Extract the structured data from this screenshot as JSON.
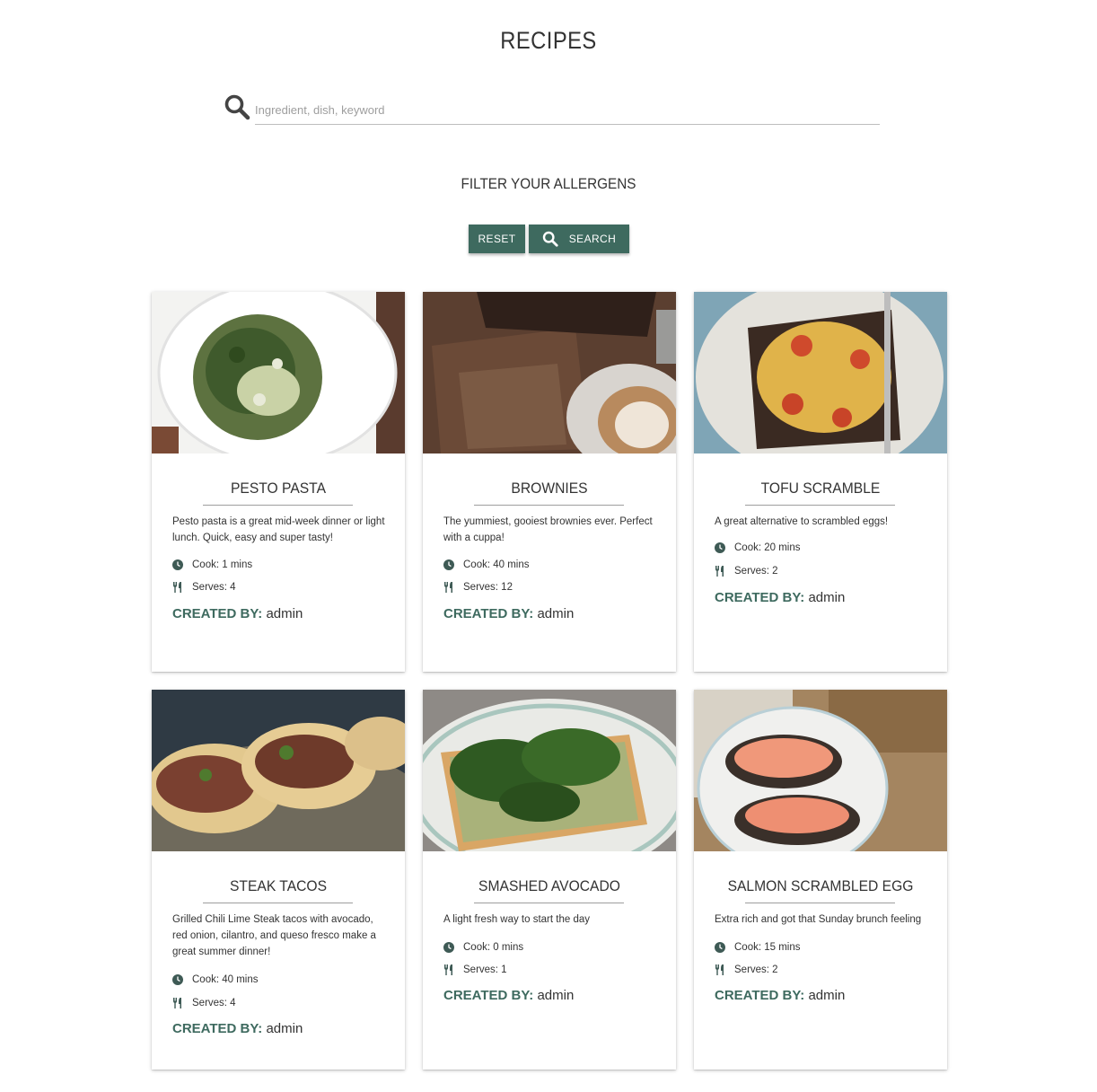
{
  "page": {
    "title": "RECIPES"
  },
  "search": {
    "placeholder": "Ingredient, dish, keyword",
    "value": ""
  },
  "filter": {
    "title": "FILTER YOUR ALLERGENS",
    "reset_label": "RESET",
    "search_label": "SEARCH"
  },
  "colors": {
    "accent": "#3e6a5f"
  },
  "recipes": [
    {
      "title": "PESTO PASTA",
      "description": "Pesto pasta is a great mid-week dinner or light lunch. Quick, easy and super tasty!",
      "cook": "Cook: 1 mins",
      "serves": "Serves: 4",
      "created_label": "CREATED BY:",
      "author": "admin"
    },
    {
      "title": "BROWNIES",
      "description": "The yummiest, gooiest brownies ever. Perfect with a cuppa!",
      "cook": "Cook: 40 mins",
      "serves": "Serves: 12",
      "created_label": "CREATED BY:",
      "author": "admin"
    },
    {
      "title": "TOFU SCRAMBLE",
      "description": "A great alternative to scrambled eggs!",
      "cook": "Cook: 20 mins",
      "serves": "Serves: 2",
      "created_label": "CREATED BY:",
      "author": "admin"
    },
    {
      "title": "STEAK TACOS",
      "description": "Grilled Chili Lime Steak tacos with avocado, red onion, cilantro, and queso fresco make a great summer dinner!",
      "cook": "Cook: 40 mins",
      "serves": "Serves: 4",
      "created_label": "CREATED BY:",
      "author": "admin"
    },
    {
      "title": "SMASHED AVOCADO",
      "description": "A light fresh way to start the day",
      "cook": "Cook: 0 mins",
      "serves": "Serves: 1",
      "created_label": "CREATED BY:",
      "author": "admin"
    },
    {
      "title": "SALMON SCRAMBLED EGG",
      "description": "Extra rich and got that Sunday brunch feeling",
      "cook": "Cook: 15 mins",
      "serves": "Serves: 2",
      "created_label": "CREATED BY:",
      "author": "admin"
    }
  ]
}
